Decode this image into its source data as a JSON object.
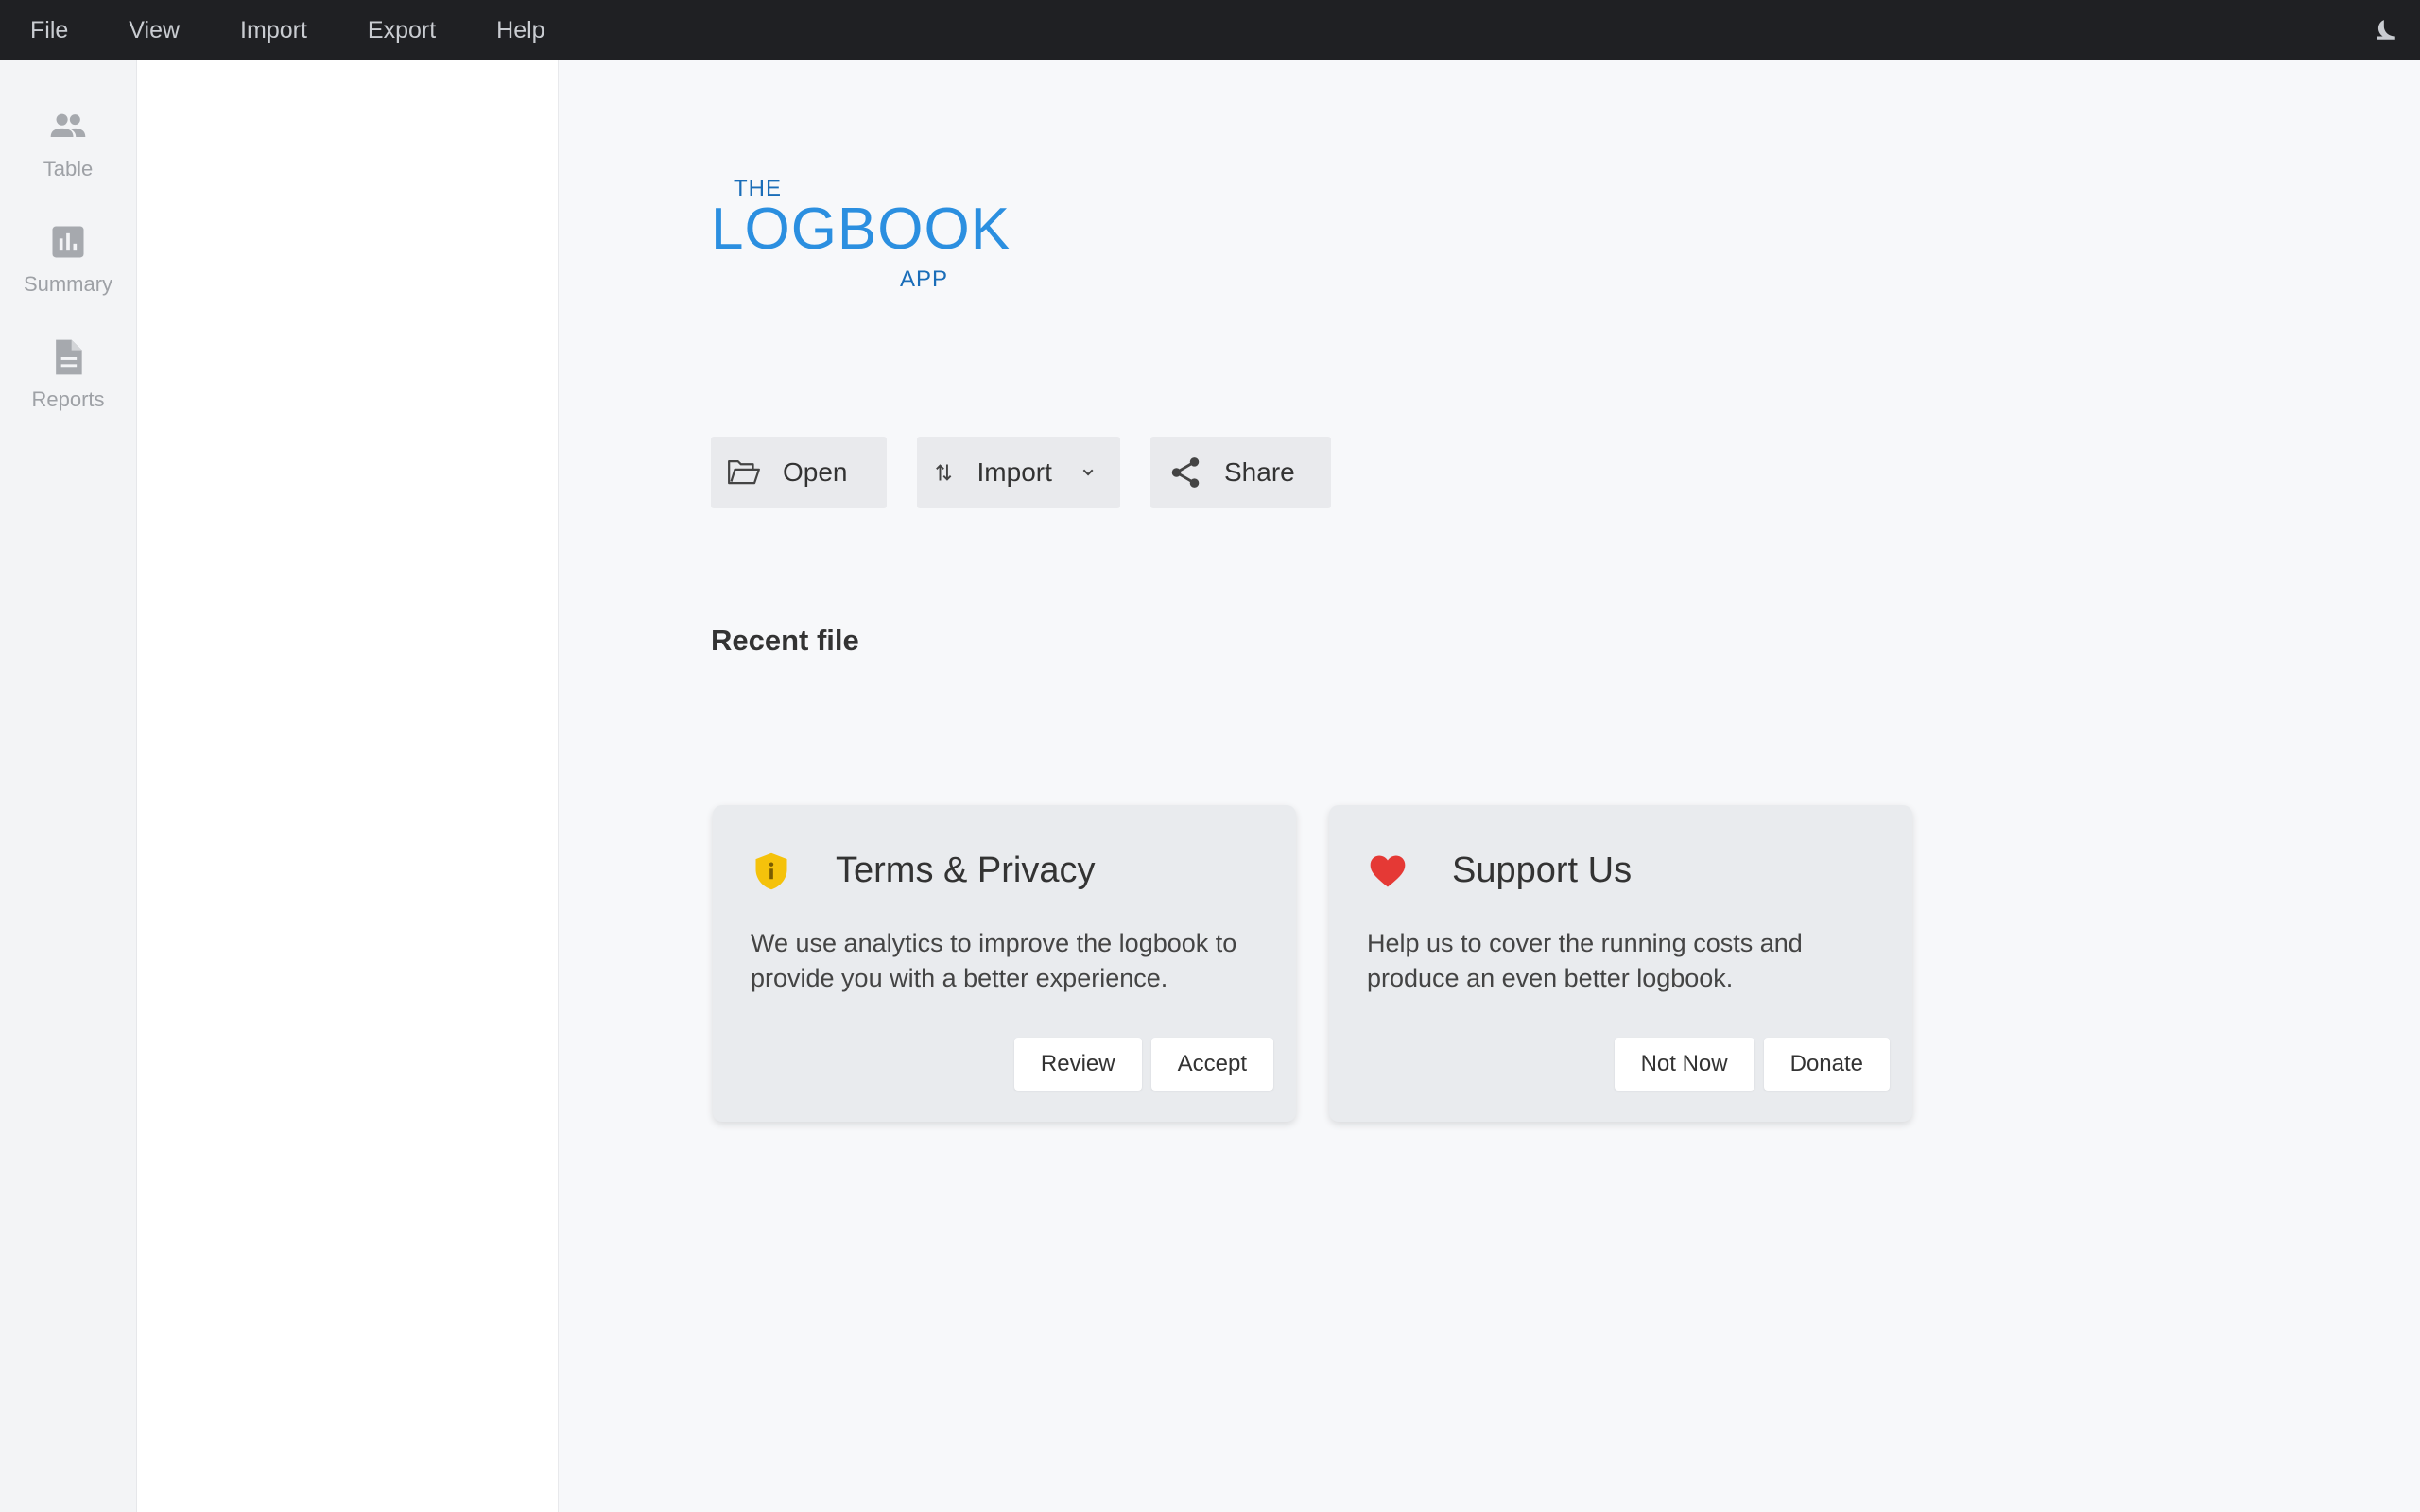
{
  "menubar": {
    "items": [
      "File",
      "View",
      "Import",
      "Export",
      "Help"
    ],
    "theme_toggle_icon": "moon-icon"
  },
  "rail": {
    "items": [
      {
        "label": "Table",
        "icon": "people-icon"
      },
      {
        "label": "Summary",
        "icon": "bar-chart-icon"
      },
      {
        "label": "Reports",
        "icon": "document-icon"
      }
    ]
  },
  "logo": {
    "the": "THE",
    "main": "LOGBOOK",
    "app": "APP"
  },
  "actions": {
    "open_label": "Open",
    "import_label": "Import",
    "share_label": "Share"
  },
  "recent": {
    "title": "Recent file"
  },
  "cards": {
    "terms": {
      "title": "Terms & Privacy",
      "text": "We use analytics to improve the logbook to provide you with a better experience.",
      "buttons": [
        "Review",
        "Accept"
      ]
    },
    "support": {
      "title": "Support Us",
      "text": "Help us to cover the running costs and produce an even better logbook.",
      "buttons": [
        "Not Now",
        "Donate"
      ]
    }
  },
  "colors": {
    "menubar_bg": "#1f2023",
    "logo_blue": "#2b8fe0",
    "shield_yellow": "#f5c20b",
    "heart_red": "#e53935"
  }
}
